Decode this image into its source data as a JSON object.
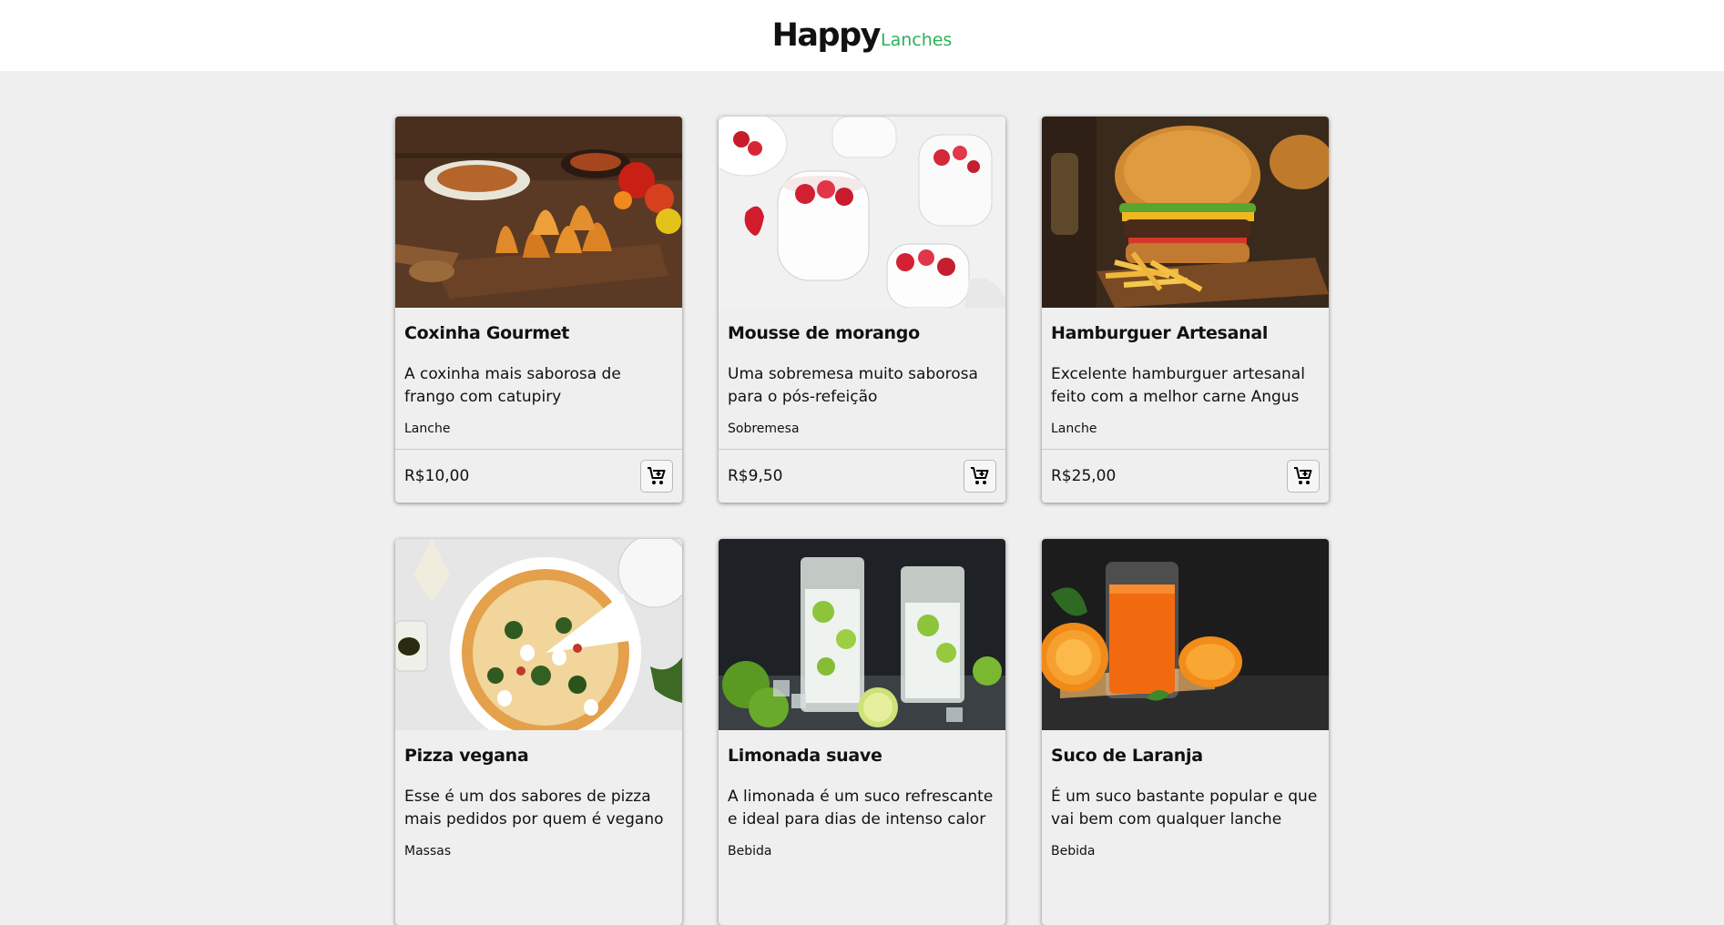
{
  "header": {
    "brand_main": "Happy",
    "brand_sub": "Lanches"
  },
  "products": [
    {
      "title": "Coxinha Gourmet",
      "description": "A coxinha mais saborosa de frango com catupiry",
      "category": "Lanche",
      "price": "R$10,00",
      "image": "coxinha-photo"
    },
    {
      "title": "Mousse de morango",
      "description": "Uma sobremesa muito saborosa para o pós-refeição",
      "category": "Sobremesa",
      "price": "R$9,50",
      "image": "strawberry-mousse-photo"
    },
    {
      "title": "Hamburguer Artesanal",
      "description": "Excelente hamburguer artesanal feito com a melhor carne Angus",
      "category": "Lanche",
      "price": "R$25,00",
      "image": "burger-photo"
    },
    {
      "title": "Pizza vegana",
      "description": "Esse é um dos sabores de pizza mais pedidos por quem é vegano",
      "category": "Massas",
      "price": "",
      "image": "pizza-photo"
    },
    {
      "title": "Limonada suave",
      "description": "A limonada é um suco refrescante e ideal para dias de intenso calor",
      "category": "Bebida",
      "price": "",
      "image": "lemonade-photo"
    },
    {
      "title": "Suco de Laranja",
      "description": "É um suco bastante popular e que vai bem com qualquer lanche",
      "category": "Bebida",
      "price": "",
      "image": "orange-juice-photo"
    }
  ],
  "icons": {
    "cart": "add-to-cart-icon"
  },
  "colors": {
    "accent": "#2ab25a",
    "page_background": "#efefef",
    "header_background": "#ffffff"
  }
}
